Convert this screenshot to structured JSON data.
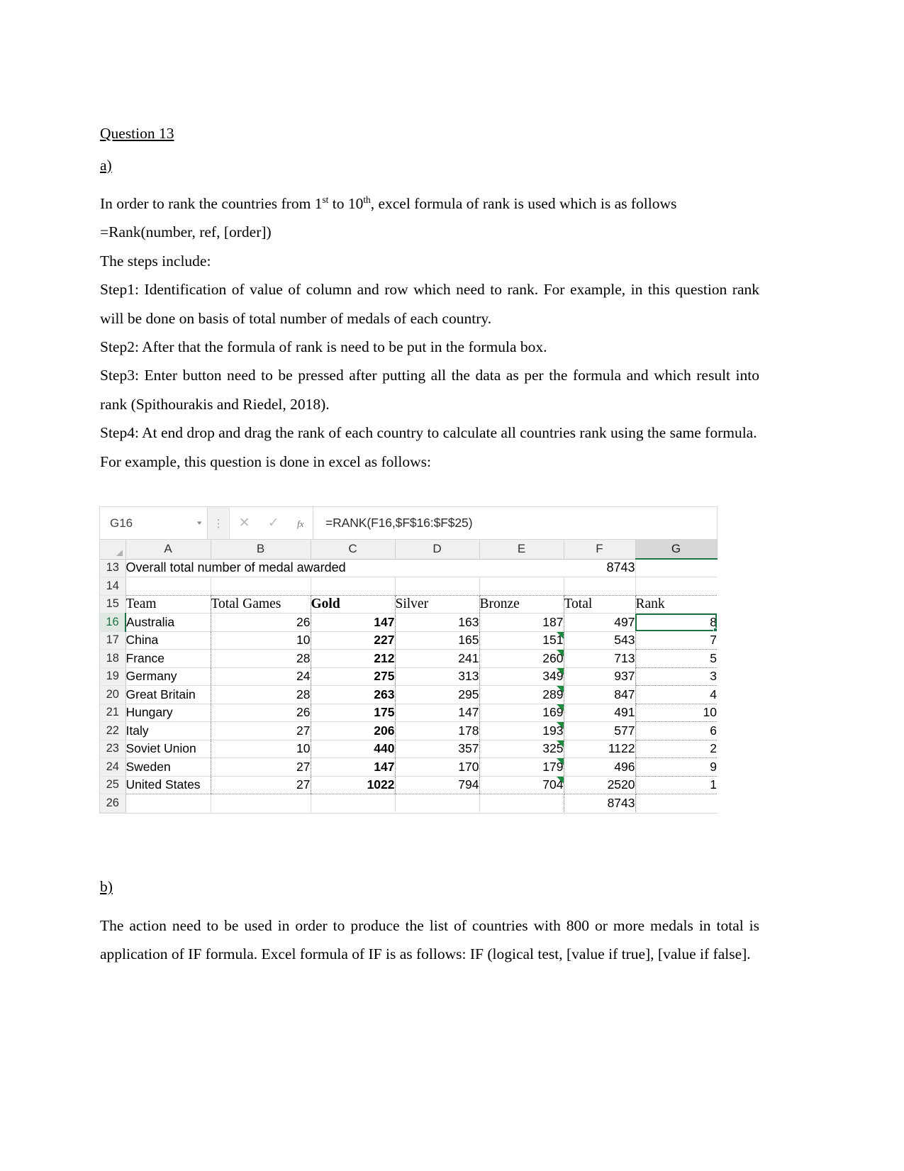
{
  "document": {
    "question_heading": "Question 13",
    "part_a_label": "a)",
    "part_b_label": "b)",
    "intro_pre": "In order to rank the countries from 1",
    "intro_sup1": "st",
    "intro_mid": " to 10",
    "intro_sup2": "th",
    "intro_post": ", excel formula of rank is used which is as follows",
    "formula_syntax": "=Rank(number, ref, [order])",
    "steps_lead": "The steps include:",
    "step1": "Step1: Identification of value of column and row which need to rank. For example, in this question rank will be done on basis of total number of medals of each country.",
    "step2": "Step2: After that the formula of rank is need to be put in the formula box.",
    "step3": "Step3: Enter button need to be pressed after putting all the data as per the formula and which result into rank (Spithourakis and Riedel, 2018).",
    "step4": "Step4: At end drop and drag the rank of each country to calculate all countries rank using the same formula.",
    "example_lead": "For example, this question is done in excel as follows:",
    "part_b_text": "The action need to be used in order to produce the list of countries with 800 or more medals in total is application of IF formula. Excel formula of IF is as follows: IF (logical test, [value if true], [value if false]."
  },
  "excel": {
    "name_box_value": "G16",
    "name_box_caret": "▾",
    "sep_icon": "⋮",
    "cancel_icon": "✕",
    "enter_icon": "✓",
    "fx_icon": "fx",
    "formula_value": "=RANK(F16,$F$16:$F$25)",
    "selected_cell": "G16",
    "selected_column": "G",
    "selected_row": "16",
    "accent_green": "#1d7244",
    "flag_green": "#1e8a3c",
    "column_headers": [
      "A",
      "B",
      "C",
      "D",
      "E",
      "F",
      "G"
    ],
    "row_numbers": [
      "13",
      "14",
      "15",
      "16",
      "17",
      "18",
      "19",
      "20",
      "21",
      "22",
      "23",
      "24",
      "25",
      "26"
    ],
    "row13": {
      "title": "Overall total number of medal awarded",
      "f_value": "8743"
    },
    "row14": {
      "empty": ""
    },
    "table_headers": [
      "Team",
      "Total Games",
      "Gold",
      "Silver",
      "Bronze",
      "Total",
      "Rank"
    ],
    "rows": [
      {
        "row": "16",
        "team": "Australia",
        "games": "26",
        "gold": "147",
        "silver": "163",
        "bronze": "187",
        "total": "497",
        "rank": "8"
      },
      {
        "row": "17",
        "team": "China",
        "games": "10",
        "gold": "227",
        "silver": "165",
        "bronze": "151",
        "total": "543",
        "rank": "7"
      },
      {
        "row": "18",
        "team": "France",
        "games": "28",
        "gold": "212",
        "silver": "241",
        "bronze": "260",
        "total": "713",
        "rank": "5"
      },
      {
        "row": "19",
        "team": "Germany",
        "games": "24",
        "gold": "275",
        "silver": "313",
        "bronze": "349",
        "total": "937",
        "rank": "3"
      },
      {
        "row": "20",
        "team": "Great Britain",
        "games": "28",
        "gold": "263",
        "silver": "295",
        "bronze": "289",
        "total": "847",
        "rank": "4"
      },
      {
        "row": "21",
        "team": "Hungary",
        "games": "26",
        "gold": "175",
        "silver": "147",
        "bronze": "169",
        "total": "491",
        "rank": "10"
      },
      {
        "row": "22",
        "team": "Italy",
        "games": "27",
        "gold": "206",
        "silver": "178",
        "bronze": "193",
        "total": "577",
        "rank": "6"
      },
      {
        "row": "23",
        "team": "Soviet Union",
        "games": "10",
        "gold": "440",
        "silver": "357",
        "bronze": "325",
        "total": "1122",
        "rank": "2"
      },
      {
        "row": "24",
        "team": "Sweden",
        "games": "27",
        "gold": "147",
        "silver": "170",
        "bronze": "179",
        "total": "496",
        "rank": "9"
      },
      {
        "row": "25",
        "team": "United States",
        "games": "27",
        "gold": "1022",
        "silver": "794",
        "bronze": "704",
        "total": "2520",
        "rank": "1"
      }
    ],
    "row26": {
      "total": "8743"
    }
  }
}
